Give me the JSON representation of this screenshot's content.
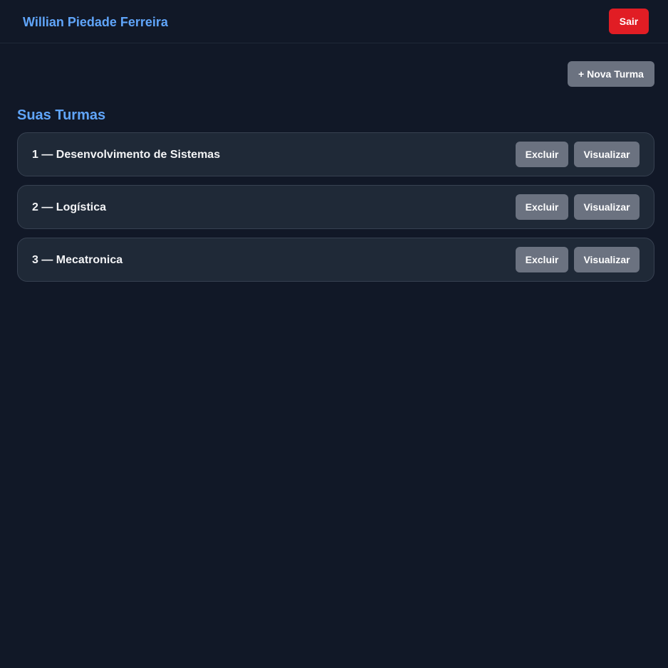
{
  "header": {
    "user_name": "Willian Piedade Ferreira",
    "logout_label": "Sair"
  },
  "toolbar": {
    "new_class_label": "+ Nova Turma"
  },
  "section": {
    "title": "Suas Turmas"
  },
  "classes": [
    {
      "label": "1 — Desenvolvimento de Sistemas",
      "delete_label": "Excluir",
      "view_label": "Visualizar"
    },
    {
      "label": "2 — Logística",
      "delete_label": "Excluir",
      "view_label": "Visualizar"
    },
    {
      "label": "3 — Mecatronica",
      "delete_label": "Excluir",
      "view_label": "Visualizar"
    }
  ],
  "colors": {
    "background": "#111827",
    "accent": "#60a5fa",
    "danger": "#e11d24",
    "button_gray": "#6b7280",
    "card": "#1f2937"
  }
}
